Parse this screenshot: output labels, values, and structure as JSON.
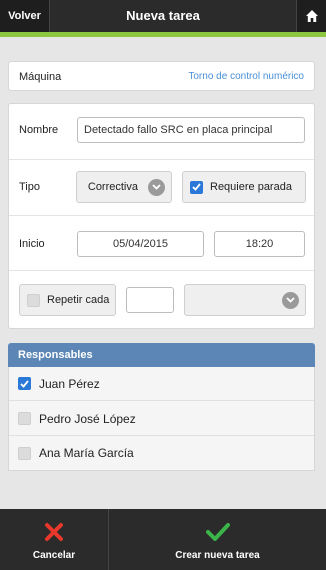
{
  "header": {
    "back_label": "Volver",
    "title": "Nueva tarea"
  },
  "machine": {
    "label": "Máquina",
    "value": "Torno de control numérico",
    "value_color": "#4a8fd6"
  },
  "form": {
    "name_label": "Nombre",
    "name_value": "Detectado fallo SRC en placa principal",
    "type_label": "Tipo",
    "type_value": "Correctiva",
    "requires_stop_label": "Requiere parada",
    "requires_stop_checked": true,
    "start_label": "Inicio",
    "start_date": "05/04/2015",
    "start_time": "18:20",
    "repeat_label": "Repetir cada",
    "repeat_checked": false,
    "repeat_value": "",
    "repeat_unit": ""
  },
  "responsables": {
    "title": "Responsables",
    "items": [
      {
        "name": "Juan Pérez",
        "checked": true
      },
      {
        "name": "Pedro José López",
        "checked": false
      },
      {
        "name": "Ana María García",
        "checked": false
      }
    ]
  },
  "footer": {
    "cancel_label": "Cancelar",
    "create_label": "Crear nueva tarea"
  },
  "colors": {
    "accent_green": "#8dc63f",
    "header_bg": "#2b2b2b",
    "checkbox_blue": "#2a79d8",
    "cancel_red": "#e8382b",
    "create_green": "#3bb54a"
  },
  "icons": {
    "home": "home-icon",
    "chevron": "chevron-down-icon",
    "cancel": "cross-icon",
    "create": "checkmark-icon"
  }
}
